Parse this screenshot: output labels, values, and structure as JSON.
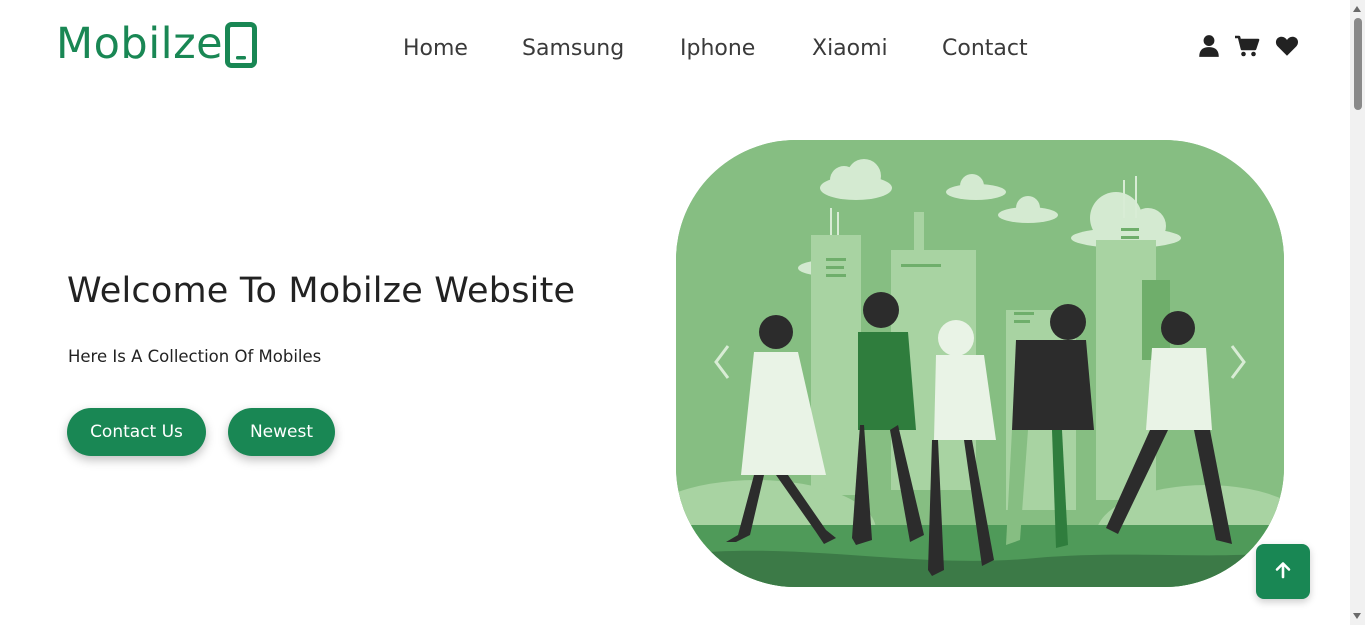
{
  "brand": {
    "name": "Mobilze",
    "icon": "mobile-phone-icon",
    "color": "#198754"
  },
  "nav": {
    "items": [
      {
        "label": "Home"
      },
      {
        "label": "Samsung"
      },
      {
        "label": "Iphone"
      },
      {
        "label": "Xiaomi"
      },
      {
        "label": "Contact"
      }
    ]
  },
  "header_icons": [
    "user-icon",
    "shopping-cart-icon",
    "heart-icon"
  ],
  "hero": {
    "title": "Welcome To Mobilze Website",
    "subtitle": "Here Is A Collection Of Mobiles",
    "buttons": {
      "contact_label": "Contact Us",
      "newest_label": "Newest"
    },
    "image": "people-using-smartphones-illustration",
    "carousel_controls": [
      "chevron-left-icon",
      "chevron-right-icon"
    ]
  },
  "back_to_top": {
    "icon": "arrow-up-icon"
  },
  "colors": {
    "accent": "#198754",
    "illustration_bg": "#86be82",
    "text": "#222222"
  }
}
